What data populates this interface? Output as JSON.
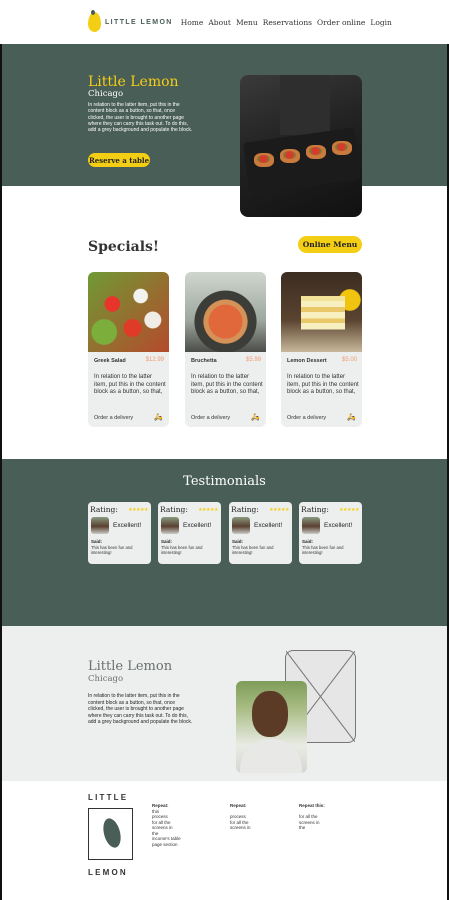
{
  "nav": {
    "logo_text": "LITTLE LEMON",
    "links": [
      "Home",
      "About",
      "Menu",
      "Reservations",
      "Order online",
      "Login"
    ]
  },
  "hero": {
    "title": "Little Lemon",
    "subtitle": "Chicago",
    "description": "In relation to the latter item, put this in the content block as a button, so that, once clicked, the user is brought to another page where they can carry this task out. To do this, add a grey background and populate the block.",
    "button": "Reserve a table"
  },
  "specials": {
    "title": "Specials!",
    "button": "Online Menu",
    "cards": [
      {
        "name": "Greek Salad",
        "price": "$12.99",
        "desc": "In relation to the latter item, put this in the content block as a button, so that,",
        "order": "Order a delivery",
        "icon": "delivery-icon"
      },
      {
        "name": "Bruchetta",
        "price": "$5.99",
        "desc": "In relation to the latter item, put this in the content block as a button, so that,",
        "order": "Order a delivery",
        "icon": "delivery-icon"
      },
      {
        "name": "Lemon Dessert",
        "price": "$5.00",
        "desc": "In relation to the latter item, put this in the content block as a button, so that,",
        "order": "Order a delivery",
        "icon": "delivery-icon"
      }
    ]
  },
  "testimonials": {
    "title": "Testimonials",
    "cards": [
      {
        "rating": "Rating:",
        "stars": "★★★★★",
        "label": "Excellent!",
        "said": "Said:",
        "text": "This has been fun and interesting!"
      },
      {
        "rating": "Rating:",
        "stars": "★★★★★",
        "label": "Excellent!",
        "said": "Said:",
        "text": "This has been fun and interesting!"
      },
      {
        "rating": "Rating:",
        "stars": "★★★★★",
        "label": "Excellent!",
        "said": "Said:",
        "text": "This has been fun and interesting!"
      },
      {
        "rating": "Rating:",
        "stars": "★★★★★",
        "label": "Excellent!",
        "said": "Said:",
        "text": "This has been fun and interesting!"
      }
    ]
  },
  "about": {
    "title": "Little Lemon",
    "subtitle": "Chicago",
    "description": "In relation to the latter item, put this in the content block as a button, so that, once clicked, the user is brought to another page where they can carry this task out. To do this, add a grey background and populate the block."
  },
  "footer": {
    "logo_top": "LITTLE",
    "logo_bottom": "LEMON",
    "columns": [
      {
        "head": "Repeat:",
        "lines": [
          "this",
          "process",
          "for all the",
          "screens in",
          "the",
          "income's table",
          "page section"
        ]
      },
      {
        "head": "Repeat:",
        "lines": [
          "process",
          "for all the",
          "screens in"
        ]
      },
      {
        "head": "Repeat this:",
        "lines": [
          "for all the",
          "screens in",
          "the"
        ]
      }
    ]
  },
  "colors": {
    "primary_green": "#495e57",
    "primary_yellow": "#f4ce14",
    "price_orange": "#ee9972",
    "light_gray": "#edefee"
  }
}
